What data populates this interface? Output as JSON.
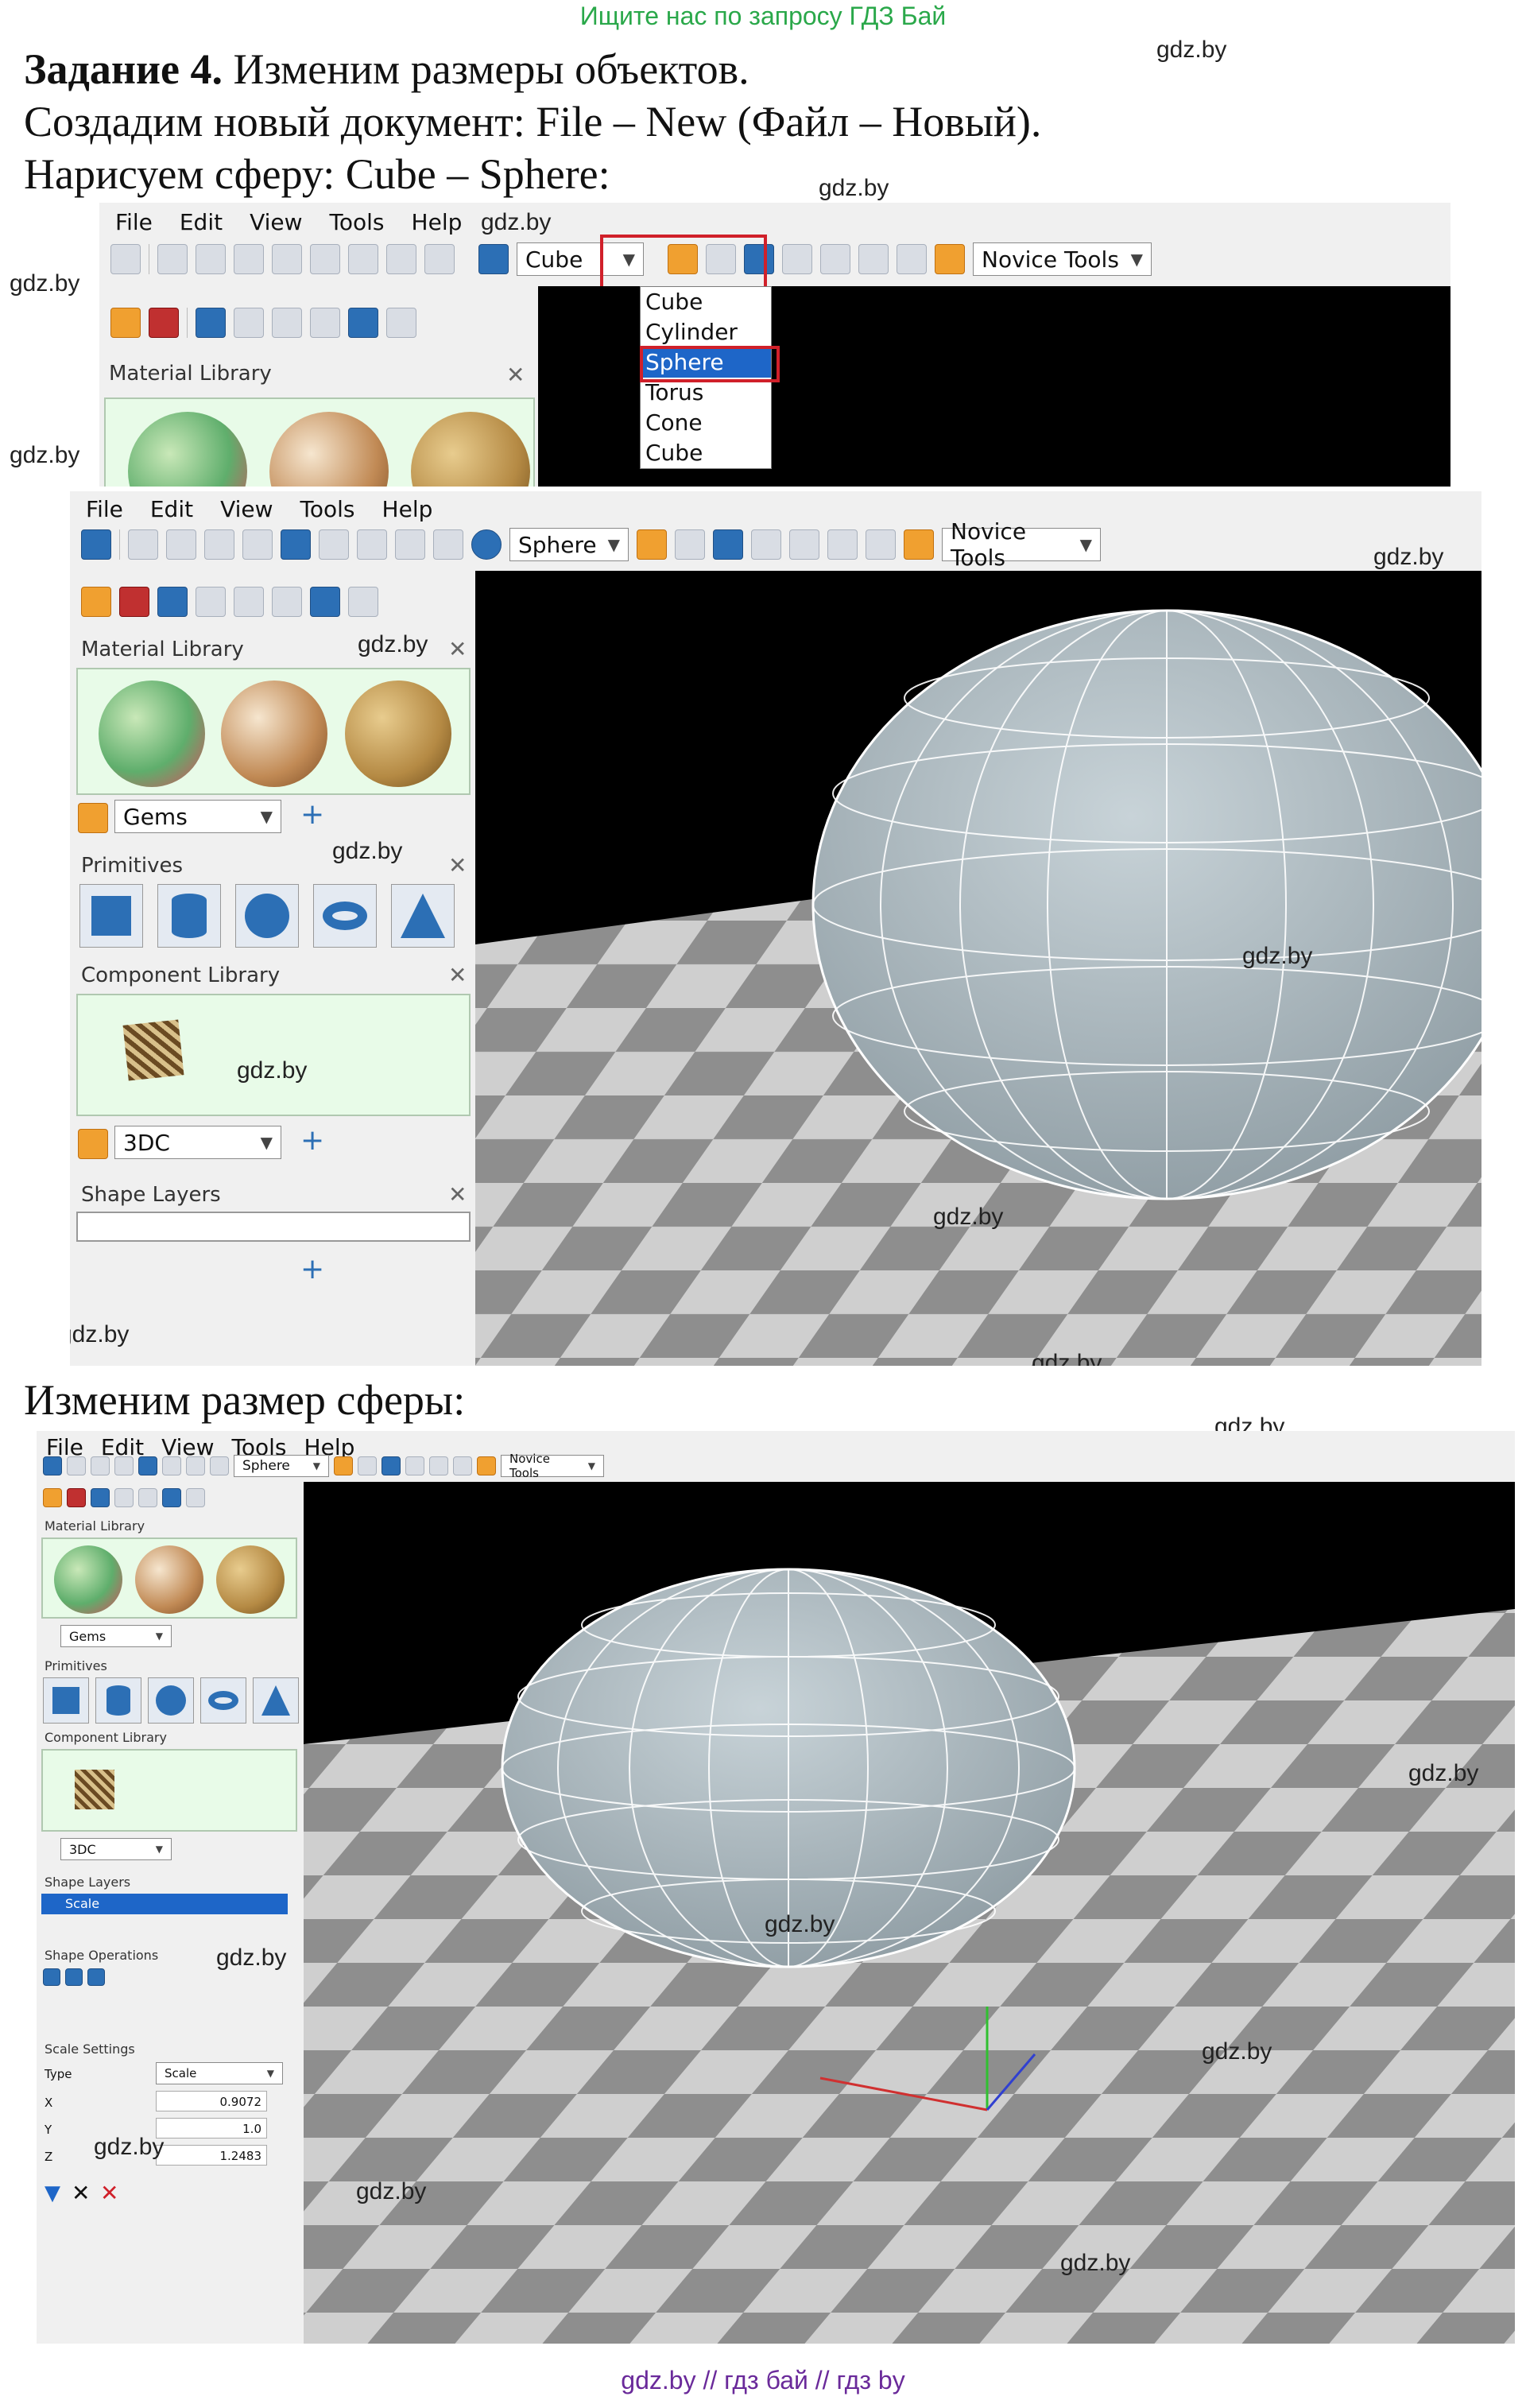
{
  "banner": "Ищите нас по запросу ГДЗ Бай",
  "task": {
    "label": "Задание 4.",
    "line1": "Изменим размеры объектов.",
    "line2": "Создадим новый документ: File – New (Файл – Новый).",
    "line3": "Нарисуем сферу: Cube – Sphere:",
    "line4": "Изменим размер сферы:"
  },
  "watermark": "gdz.by",
  "menu": [
    "File",
    "Edit",
    "View",
    "Tools",
    "Help"
  ],
  "shape_combo": {
    "first": "Cube",
    "second": "Sphere"
  },
  "novice_tools": "Novice Tools",
  "dropdown": [
    "Cube",
    "Cylinder",
    "Sphere",
    "Torus",
    "Cone",
    "Cube"
  ],
  "dropdown_selected_index": 2,
  "panels": {
    "material_library": "Material Library",
    "gems": "Gems",
    "primitives": "Primitives",
    "component_library": "Component Library",
    "component_combo": "3DC",
    "shape_layers": "Shape Layers",
    "layer_scale": "Scale",
    "shape_operations": "Shape Operations",
    "scale_settings": "Scale Settings"
  },
  "scale_settings": {
    "type_label": "Type",
    "type_value": "Scale",
    "x_label": "X",
    "x_value": "0.9072",
    "y_label": "Y",
    "y_value": "1.0",
    "z_label": "Z",
    "z_value": "1.2483"
  },
  "footer": "gdz.by  //  гдз бай  //  гдз by",
  "colors": {
    "banner": "#2aa84a",
    "footer": "#6a2a9a",
    "highlight_red": "#d0202a",
    "selection_blue": "#1e66c8",
    "sphere": "#a9b6bd",
    "floor_dark": "#8e8e8e",
    "floor_light": "#cfcfcf"
  }
}
